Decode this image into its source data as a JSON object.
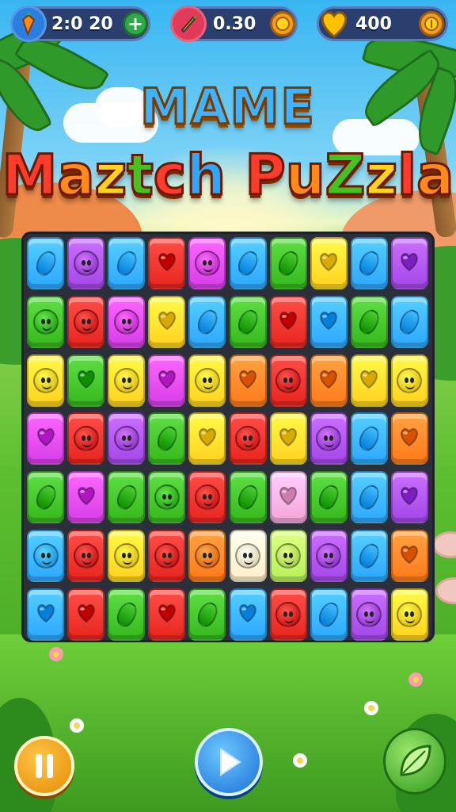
{
  "hud": {
    "lives": {
      "text": "2:0  20",
      "icon": "carrot-icon",
      "button": "+",
      "color": "#ff8a1a"
    },
    "rocket": {
      "text": "0.30",
      "icon": "rocket-icon",
      "button": "coin",
      "color": "#e23b5a"
    },
    "coins": {
      "text": "400",
      "icon": "gold-heart-icon",
      "button": "coin",
      "color": "#ffc000"
    }
  },
  "title": {
    "line1": "MAME",
    "line2": "Maztch PuZzla"
  },
  "colors": {
    "blue": "#2da7ff",
    "purple": "#a347e8",
    "red": "#e8251f",
    "magenta": "#d63ee8",
    "green": "#36b81d",
    "yellow": "#ffd21f",
    "orange": "#ff7a1a",
    "pink": "#f4a6d7",
    "cream": "#fff0c8",
    "lime": "#b6f05a"
  },
  "board": {
    "rows": [
      [
        [
          "blue",
          "bean"
        ],
        [
          "purple",
          "face"
        ],
        [
          "blue",
          "bean"
        ],
        [
          "red",
          "heart"
        ],
        [
          "magenta",
          "face"
        ],
        [
          "blue",
          "bean"
        ],
        [
          "green",
          "bean"
        ],
        [
          "yellow",
          "heart"
        ],
        [
          "blue",
          "bean"
        ],
        [
          "purple",
          "heart"
        ]
      ],
      [
        [
          "green",
          "face"
        ],
        [
          "red",
          "face"
        ],
        [
          "magenta",
          "face"
        ],
        [
          "yellow",
          "heart"
        ],
        [
          "blue",
          "bean"
        ],
        [
          "green",
          "bean"
        ],
        [
          "red",
          "heart"
        ],
        [
          "blue",
          "heart"
        ],
        [
          "green",
          "bean"
        ],
        [
          "blue",
          "bean"
        ]
      ],
      [
        [
          "yellow",
          "face"
        ],
        [
          "green",
          "heart"
        ],
        [
          "yellow",
          "face"
        ],
        [
          "magenta",
          "heart"
        ],
        [
          "yellow",
          "face"
        ],
        [
          "orange",
          "heart"
        ],
        [
          "red",
          "face"
        ],
        [
          "orange",
          "heart"
        ],
        [
          "yellow",
          "heart"
        ],
        [
          "yellow",
          "face"
        ]
      ],
      [
        [
          "magenta",
          "heart"
        ],
        [
          "red",
          "face"
        ],
        [
          "purple",
          "face"
        ],
        [
          "green",
          "bean"
        ],
        [
          "yellow",
          "heart"
        ],
        [
          "red",
          "face"
        ],
        [
          "yellow",
          "heart"
        ],
        [
          "purple",
          "face"
        ],
        [
          "blue",
          "bean"
        ],
        [
          "orange",
          "heart"
        ]
      ],
      [
        [
          "green",
          "bean"
        ],
        [
          "magenta",
          "heart"
        ],
        [
          "green",
          "bean"
        ],
        [
          "green",
          "face"
        ],
        [
          "red",
          "face"
        ],
        [
          "green",
          "bean"
        ],
        [
          "pink",
          "heart"
        ],
        [
          "green",
          "bean"
        ],
        [
          "blue",
          "bean"
        ],
        [
          "purple",
          "heart"
        ]
      ],
      [
        [
          "blue",
          "face"
        ],
        [
          "red",
          "face"
        ],
        [
          "yellow",
          "face"
        ],
        [
          "red",
          "face"
        ],
        [
          "orange",
          "face"
        ],
        [
          "cream",
          "face"
        ],
        [
          "lime",
          "face"
        ],
        [
          "purple",
          "face"
        ],
        [
          "blue",
          "bean"
        ],
        [
          "orange",
          "heart"
        ]
      ],
      [
        [
          "blue",
          "heart"
        ],
        [
          "red",
          "heart"
        ],
        [
          "green",
          "bean"
        ],
        [
          "red",
          "heart"
        ],
        [
          "green",
          "bean"
        ],
        [
          "blue",
          "heart"
        ],
        [
          "red",
          "face"
        ],
        [
          "blue",
          "bean"
        ],
        [
          "purple",
          "face"
        ],
        [
          "yellow",
          "face"
        ]
      ]
    ]
  },
  "controls": {
    "pause": {
      "icon": "pause-icon"
    },
    "play": {
      "icon": "play-icon"
    },
    "leaf": {
      "icon": "leaf-icon"
    }
  }
}
